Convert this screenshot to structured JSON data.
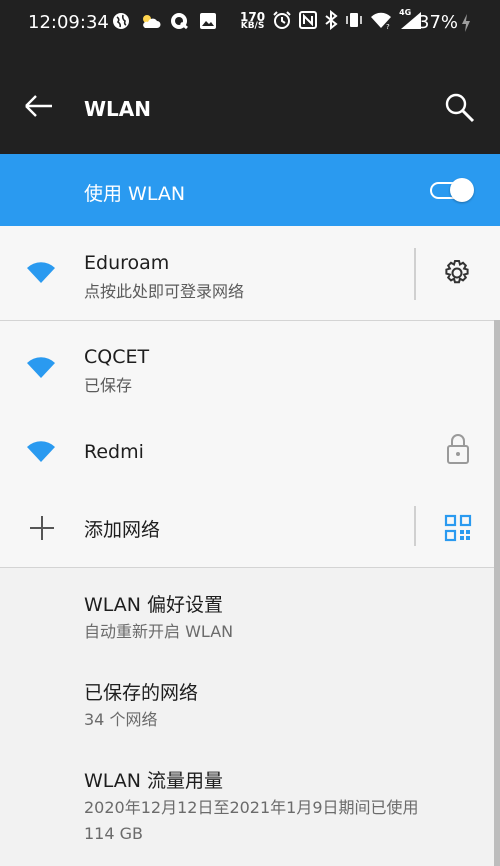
{
  "status": {
    "time": "12:09:34",
    "netspeed_value": "170",
    "netspeed_unit": "KB/S",
    "network_type": "4G",
    "battery": "37%"
  },
  "appbar": {
    "title": "WLAN"
  },
  "wlan_toggle": {
    "label": "使用 WLAN",
    "enabled": true
  },
  "networks": [
    {
      "name": "Eduroam",
      "status": "点按此处即可登录网络",
      "connected": true
    },
    {
      "name": "CQCET",
      "status": "已保存"
    },
    {
      "name": "Redmi",
      "status": "",
      "locked": true
    }
  ],
  "add_network": {
    "label": "添加网络"
  },
  "settings": [
    {
      "title": "WLAN 偏好设置",
      "subtitle": "自动重新开启 WLAN"
    },
    {
      "title": "已保存的网络",
      "subtitle": "34 个网络"
    },
    {
      "title": "WLAN 流量用量",
      "subtitle": "2020年12月12日至2021年1月9日期间已使用",
      "subtitle2": "114 GB"
    }
  ],
  "colors": {
    "accent": "#2a9af0",
    "dark_bar": "#212121"
  }
}
